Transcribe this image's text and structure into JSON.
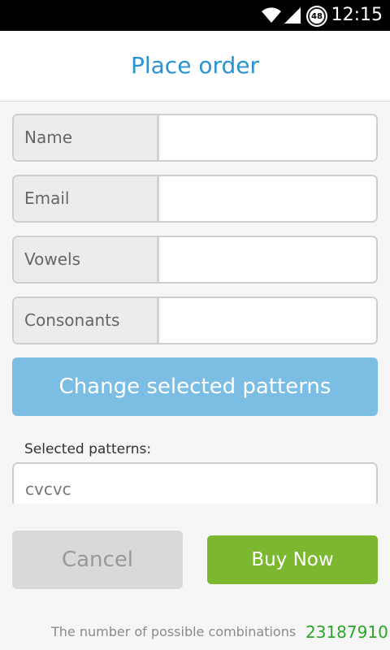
{
  "status_bar": {
    "time": "12:15",
    "battery_level": "48",
    "icons": [
      "wifi-icon",
      "signal-icon",
      "battery-icon"
    ]
  },
  "header": {
    "title": "Place order"
  },
  "form": {
    "fields": [
      {
        "label": "Name",
        "value": ""
      },
      {
        "label": "Email",
        "value": ""
      },
      {
        "label": "Vowels",
        "value": ""
      },
      {
        "label": "Consonants",
        "value": ""
      }
    ]
  },
  "change_patterns_label": "Change selected patterns",
  "selected_patterns": {
    "label": "Selected patterns:",
    "value": "cvcvc"
  },
  "actions": {
    "cancel_label": "Cancel",
    "buy_label": "Buy Now"
  },
  "combinations": {
    "label": "The number of possible combinations",
    "value": "23187910"
  },
  "colors": {
    "title": "#2a93d1",
    "change_button": "#7bbde3",
    "buy_button": "#7cb82f",
    "cancel_button": "#d9d9d9",
    "combinations_value": "#2aa52a"
  }
}
